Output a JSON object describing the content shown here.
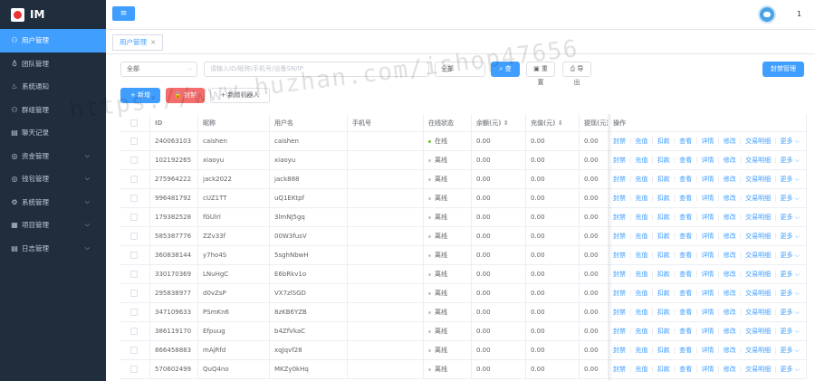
{
  "app": {
    "title": "IM"
  },
  "sidebar": {
    "items": [
      {
        "label": "用户管理",
        "icon": "user-icon",
        "glyph": "⚇",
        "active": true,
        "arrow": false
      },
      {
        "label": "团队管理",
        "icon": "team-icon",
        "glyph": "♁",
        "active": false,
        "arrow": false
      },
      {
        "label": "系统通知",
        "icon": "bell-icon",
        "glyph": "♨",
        "active": false,
        "arrow": false
      },
      {
        "label": "群组管理",
        "icon": "group-icon",
        "glyph": "⚇",
        "active": false,
        "arrow": false
      },
      {
        "label": "聊天记录",
        "icon": "chat-icon",
        "glyph": "▤",
        "active": false,
        "arrow": false
      },
      {
        "label": "资金管理",
        "icon": "money-icon",
        "glyph": "◎",
        "active": false,
        "arrow": true
      },
      {
        "label": "钱包管理",
        "icon": "wallet-icon",
        "glyph": "◎",
        "active": false,
        "arrow": true
      },
      {
        "label": "系统管理",
        "icon": "gear-icon",
        "glyph": "⚙",
        "active": false,
        "arrow": true
      },
      {
        "label": "项目管理",
        "icon": "project-icon",
        "glyph": "▦",
        "active": false,
        "arrow": true
      },
      {
        "label": "日志管理",
        "icon": "log-icon",
        "glyph": "▤",
        "active": false,
        "arrow": true
      }
    ]
  },
  "topbar": {
    "menu_icon": "≡",
    "user_count": "1"
  },
  "tabs": [
    {
      "label": "用户管理",
      "close": "×"
    }
  ],
  "filters": {
    "status_select": "全部",
    "search_placeholder": "请输入ID/昵称/手机号/设备SN/IP",
    "type_select": "全部",
    "query_label": "查 询",
    "reset_label": "重 置",
    "export_label": "导 出",
    "ban_manage_label": "封禁管理",
    "arrow": "⌵",
    "query_icon": "⌕",
    "reset_icon": "▣",
    "export_icon": "⎙"
  },
  "actions": {
    "add_label": "新增",
    "ban_label": "封禁",
    "add_robot_label": "新增机器人",
    "add_icon": "+",
    "lock_icon": "🔒"
  },
  "table": {
    "columns": [
      "ID",
      "昵称",
      "用户名",
      "手机号",
      "在线状态",
      "余额(元)",
      "充值(元)",
      "提现(元)",
      "操作"
    ],
    "sort_icon": "⇕",
    "ops": [
      "封禁",
      "充值",
      "扣款",
      "查看",
      "详情",
      "修改",
      "交易明细",
      "更多 ⌵"
    ],
    "rows": [
      {
        "id": "240063103",
        "nickname": "caishen",
        "username": "caishen",
        "phone": "",
        "status": "在线",
        "online": true,
        "balance": "0.00",
        "recharge": "0.00",
        "withdraw": "0.00"
      },
      {
        "id": "102192265",
        "nickname": "xiaoyu",
        "username": "xiaoyu",
        "phone": "",
        "status": "离线",
        "online": false,
        "balance": "0.00",
        "recharge": "0.00",
        "withdraw": "0.00"
      },
      {
        "id": "275964222",
        "nickname": "jack2022",
        "username": "jack888",
        "phone": "",
        "status": "离线",
        "online": false,
        "balance": "0.00",
        "recharge": "0.00",
        "withdraw": "0.00"
      },
      {
        "id": "996481792",
        "nickname": "cUZ1TT",
        "username": "uQ1EKtpf",
        "phone": "",
        "status": "离线",
        "online": false,
        "balance": "0.00",
        "recharge": "0.00",
        "withdraw": "0.00"
      },
      {
        "id": "179382528",
        "nickname": "fGUlrl",
        "username": "3lmNJ5gq",
        "phone": "",
        "status": "离线",
        "online": false,
        "balance": "0.00",
        "recharge": "0.00",
        "withdraw": "0.00"
      },
      {
        "id": "585387776",
        "nickname": "ZZv33f",
        "username": "00W3fusV",
        "phone": "",
        "status": "离线",
        "online": false,
        "balance": "0.00",
        "recharge": "0.00",
        "withdraw": "0.00"
      },
      {
        "id": "360838144",
        "nickname": "y7ho4S",
        "username": "5sghNbwH",
        "phone": "",
        "status": "离线",
        "online": false,
        "balance": "0.00",
        "recharge": "0.00",
        "withdraw": "0.00"
      },
      {
        "id": "330170369",
        "nickname": "LNuHgC",
        "username": "E6bRkv1o",
        "phone": "",
        "status": "离线",
        "online": false,
        "balance": "0.00",
        "recharge": "0.00",
        "withdraw": "0.00"
      },
      {
        "id": "295838977",
        "nickname": "d0vZsP",
        "username": "VX7zlSGD",
        "phone": "",
        "status": "离线",
        "online": false,
        "balance": "0.00",
        "recharge": "0.00",
        "withdraw": "0.00"
      },
      {
        "id": "347109633",
        "nickname": "PSmKn6",
        "username": "8zKB6YZB",
        "phone": "",
        "status": "离线",
        "online": false,
        "balance": "0.00",
        "recharge": "0.00",
        "withdraw": "0.00"
      },
      {
        "id": "386119170",
        "nickname": "Efpuug",
        "username": "b4ZfVkaC",
        "phone": "",
        "status": "离线",
        "online": false,
        "balance": "0.00",
        "recharge": "0.00",
        "withdraw": "0.00"
      },
      {
        "id": "866458883",
        "nickname": "mAjRfd",
        "username": "xqJqvf28",
        "phone": "",
        "status": "离线",
        "online": false,
        "balance": "0.00",
        "recharge": "0.00",
        "withdraw": "0.00"
      },
      {
        "id": "570602499",
        "nickname": "QuQ4no",
        "username": "MKZy0kHq",
        "phone": "",
        "status": "离线",
        "online": false,
        "balance": "0.00",
        "recharge": "0.00",
        "withdraw": "0.00"
      }
    ]
  },
  "watermark": "https://www.huzhan.com/ishop47656"
}
